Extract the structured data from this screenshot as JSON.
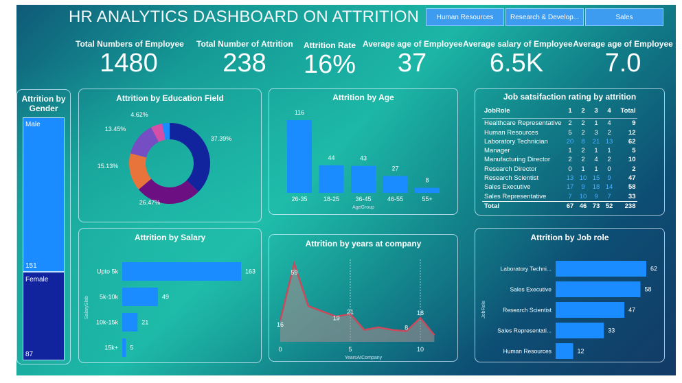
{
  "title": "HR ANALYTICS DASHBOARD ON ATTRITION",
  "slicer": [
    "Human Resources",
    "Research & Develop...",
    "Sales"
  ],
  "kpis": [
    {
      "label": "Total Numbers of Employee",
      "value": "1480"
    },
    {
      "label": "Total Number of Attrition",
      "value": "238"
    },
    {
      "label": "Attrition Rate",
      "value": "16%"
    },
    {
      "label": "Average age of Employee",
      "value": "37"
    },
    {
      "label": "Average salary of Employee",
      "value": "6.5K"
    },
    {
      "label": "Average age of Employee",
      "value": "7.0"
    }
  ],
  "colors": {
    "bar": "#1a8cff",
    "male": "#1a8cff",
    "female": "#12239e",
    "area_line": "#c84a5c"
  },
  "chart_data": [
    {
      "type": "bar",
      "title": "Attrition by Gender",
      "categories": [
        "Male",
        "Female"
      ],
      "values": [
        151,
        87
      ]
    },
    {
      "type": "pie",
      "title": "Attrition by Education Field",
      "labels": [
        "37.39%",
        "26.47%",
        "15.13%",
        "13.45%",
        "4.62%",
        ""
      ],
      "values": [
        37.39,
        26.47,
        15.13,
        13.45,
        4.62,
        2.94
      ],
      "colors": [
        "#12239e",
        "#6b0f82",
        "#e8743b",
        "#744ec2",
        "#d64fa6",
        "#1a8cff"
      ]
    },
    {
      "type": "bar",
      "title": "Attrition by Age",
      "xlabel": "AgeGroup",
      "categories": [
        "26-35",
        "18-25",
        "36-45",
        "46-55",
        "55+"
      ],
      "values": [
        116,
        44,
        43,
        27,
        8
      ]
    },
    {
      "type": "table",
      "title": "Job satsifaction rating by attrition",
      "columns": [
        "JobRole",
        "1",
        "2",
        "3",
        "4",
        "Total"
      ],
      "rows": [
        [
          "Healthcare Representative",
          "2",
          "2",
          "1",
          "4",
          "9"
        ],
        [
          "Human Resources",
          "5",
          "2",
          "3",
          "2",
          "12"
        ],
        [
          "Laboratory Technician",
          "20",
          "8",
          "21",
          "13",
          "62"
        ],
        [
          "Manager",
          "1",
          "2",
          "1",
          "1",
          "5"
        ],
        [
          "Manufacturing Director",
          "2",
          "2",
          "4",
          "2",
          "10"
        ],
        [
          "Research Director",
          "0",
          "1",
          "1",
          "0",
          "2"
        ],
        [
          "Research Scientist",
          "13",
          "10",
          "15",
          "9",
          "47"
        ],
        [
          "Sales Executive",
          "17",
          "9",
          "18",
          "14",
          "58"
        ],
        [
          "Sales Representative",
          "7",
          "10",
          "9",
          "7",
          "33"
        ]
      ],
      "total": [
        "Total",
        "67",
        "46",
        "73",
        "52",
        "238"
      ],
      "highlight_rows": [
        2,
        6,
        7,
        8
      ]
    },
    {
      "type": "bar",
      "orientation": "horizontal",
      "title": "Attrition by Salary",
      "ylabel": "SalarySlab",
      "categories": [
        "Upto 5k",
        "5k-10k",
        "10k-15k",
        "15k+"
      ],
      "values": [
        163,
        49,
        21,
        5
      ]
    },
    {
      "type": "area",
      "title": "Attrition by years at company",
      "xlabel": "YearsAtCompany",
      "x": [
        0,
        1,
        2,
        3,
        4,
        5,
        6,
        7,
        8,
        9,
        10,
        11
      ],
      "y": [
        16,
        59,
        27,
        23,
        19,
        21,
        9,
        11,
        9,
        8,
        18,
        5
      ],
      "data_labels": {
        "0": "16",
        "1": "59",
        "4": "19",
        "5": "21",
        "9": "8",
        "10": "18"
      },
      "xticks": [
        0,
        5,
        10
      ],
      "ylim": [
        0,
        60
      ]
    },
    {
      "type": "bar",
      "orientation": "horizontal",
      "title": "Attrition by Job role",
      "ylabel": "JobRole",
      "categories": [
        "Laboratory Techni...",
        "Sales Executive",
        "Research Scientist",
        "Sales Representati...",
        "Human Resources"
      ],
      "values": [
        62,
        58,
        47,
        33,
        12
      ]
    }
  ]
}
